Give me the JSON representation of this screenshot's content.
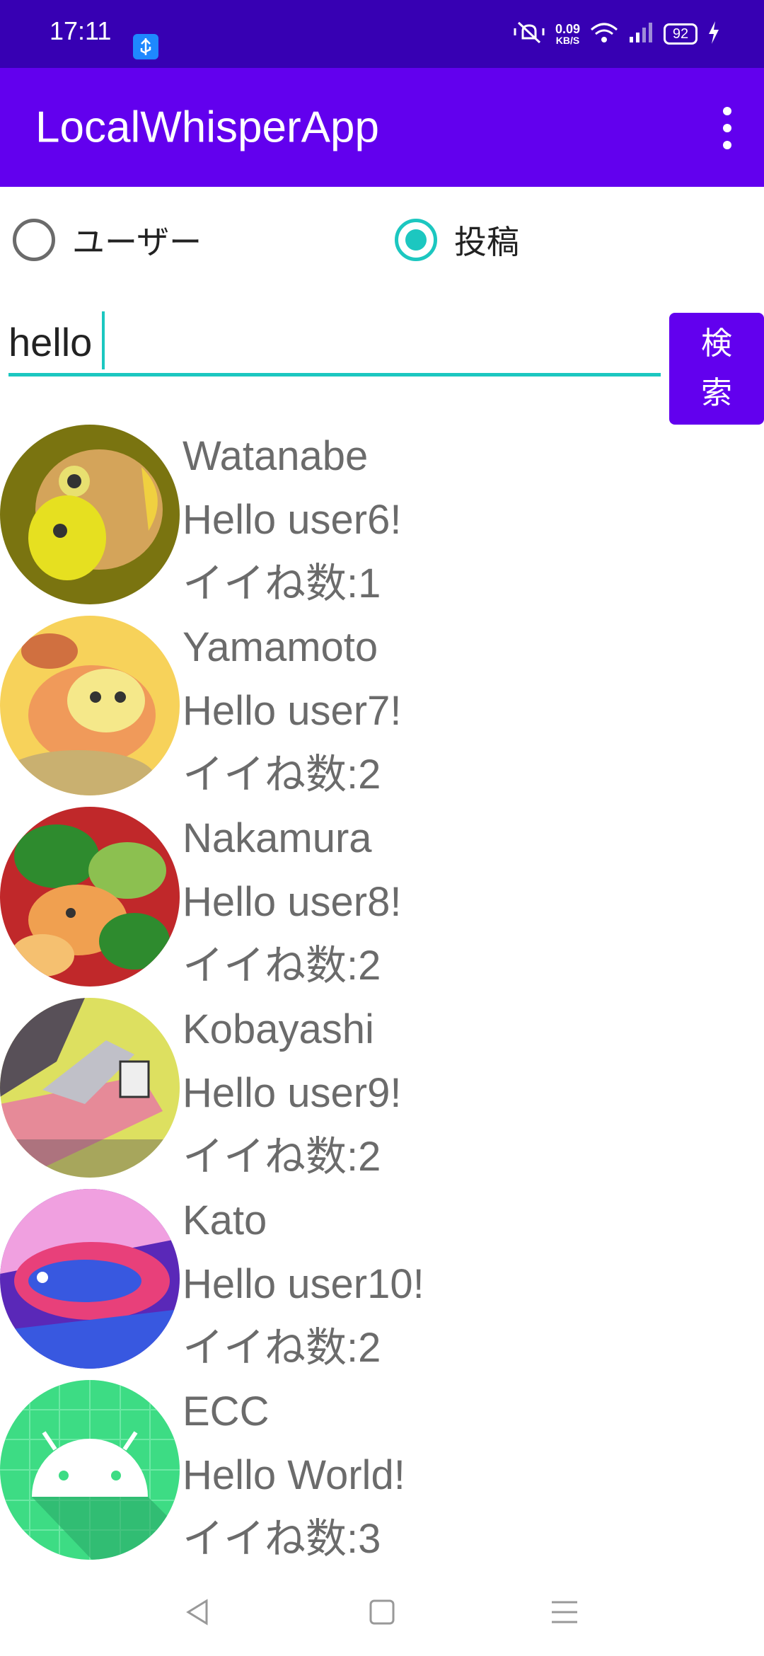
{
  "status": {
    "time": "17:11",
    "speed_value": "0.09",
    "speed_unit": "KB/S",
    "battery": "92"
  },
  "app": {
    "title": "LocalWhisperApp"
  },
  "filter": {
    "users_label": "ユーザー",
    "posts_label": "投稿",
    "selected": "posts"
  },
  "search": {
    "query": "hello",
    "button_label_line1": "検",
    "button_label_line2": "索"
  },
  "posts": [
    {
      "name": "Watanabe",
      "message": "Hello user6!",
      "likes": "イイね数:1"
    },
    {
      "name": "Yamamoto",
      "message": "Hello user7!",
      "likes": "イイね数:2"
    },
    {
      "name": "Nakamura",
      "message": "Hello user8!",
      "likes": "イイね数:2"
    },
    {
      "name": "Kobayashi",
      "message": "Hello user9!",
      "likes": "イイね数:2"
    },
    {
      "name": "Kato",
      "message": "Hello user10!",
      "likes": "イイね数:2"
    },
    {
      "name": "ECC",
      "message": "Hello World!",
      "likes": "イイね数:3"
    }
  ],
  "colors": {
    "status_bar": "#3700b3",
    "app_bar": "#6200ee",
    "accent": "#1cc7c0",
    "text_secondary": "#6b6b6b"
  }
}
